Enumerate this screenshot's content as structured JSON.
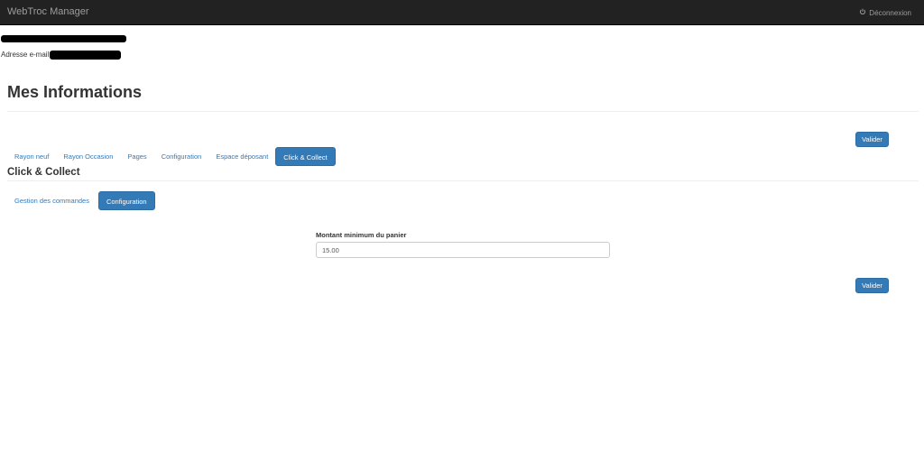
{
  "navbar": {
    "brand": "WebTroc Manager",
    "logout_label": "Déconnexion",
    "logout_icon": "power-icon"
  },
  "user": {
    "email_label": "Adresse e-mail:"
  },
  "page": {
    "title": "Mes Informations",
    "validate_label": "Valider"
  },
  "tabs": [
    {
      "label": "Rayon neuf",
      "active": false
    },
    {
      "label": "Rayon Occasion",
      "active": false
    },
    {
      "label": "Pages",
      "active": false
    },
    {
      "label": "Configuration",
      "active": false
    },
    {
      "label": "Espace déposant",
      "active": false
    },
    {
      "label": "Click & Collect",
      "active": true
    }
  ],
  "section": {
    "title": "Click & Collect",
    "subtabs": [
      {
        "label": "Gestion des commandes",
        "active": false
      },
      {
        "label": "Configuration",
        "active": true
      }
    ]
  },
  "form": {
    "min_basket_label": "Montant minimum du panier",
    "min_basket_value": "15.00",
    "validate_label": "Valider"
  },
  "colors": {
    "navbar": "#222222",
    "primary": "#337ab7",
    "link": "#337ab7"
  }
}
